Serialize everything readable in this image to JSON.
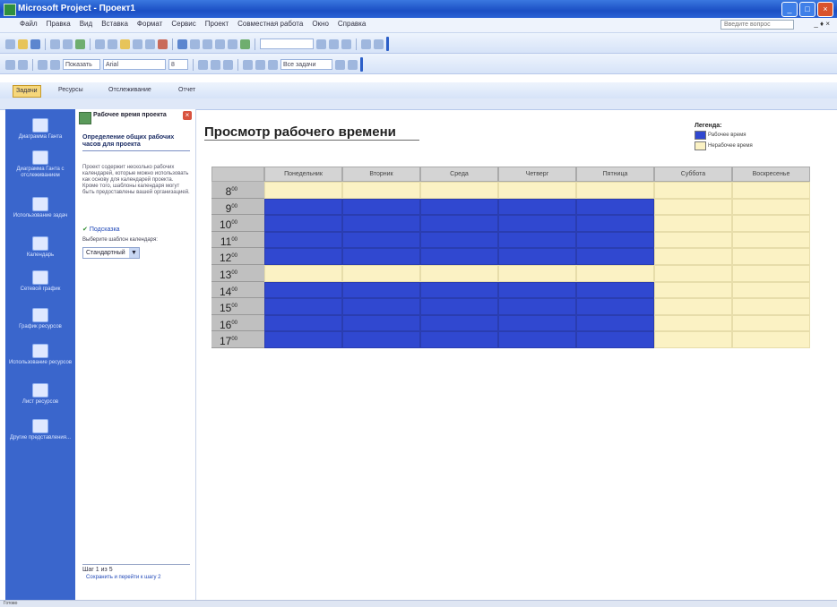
{
  "window": {
    "title": "Microsoft Project - Проект1",
    "buttons": [
      "_",
      "□",
      "×"
    ]
  },
  "menubar": {
    "items": [
      "Файл",
      "Правка",
      "Вид",
      "Вставка",
      "Формат",
      "Сервис",
      "Проект",
      "Совместная работа",
      "Окно",
      "Справка"
    ],
    "help_placeholder": "Введите вопрос",
    "controls": "_ ♦ ×"
  },
  "toolbar": {
    "font_size": "8",
    "font_name": "Arial",
    "filter": "Все задачи",
    "view": "Показать"
  },
  "guide_bar": {
    "tabs": [
      "Задачи",
      "Ресурсы",
      "Отслеживание",
      "Отчет"
    ]
  },
  "left_nav": {
    "items": [
      "Диаграмма Ганта",
      "Диаграмма Ганта с отслеживанием",
      "Использование задач",
      "Календарь",
      "Сетевой график",
      "График ресурсов",
      "Использование ресурсов",
      "Лист ресурсов",
      "Другие представления..."
    ]
  },
  "side_pane": {
    "title": "Рабочее время проекта",
    "subtitle": "Определение общих рабочих часов для проекта",
    "text": "Проект содержит несколько рабочих календарей, которые можно использовать как основу для календарей проекта. Кроме того, шаблоны календаря могут быть предоставлены вашей организацией.",
    "link": "Подсказка",
    "select_label": "Выберите шаблон календаря:",
    "select_value": "Стандартный",
    "step": "Шаг 1 из 5",
    "next": "Сохранить и перейти к шагу 2"
  },
  "view": {
    "title": "Просмотр рабочего времени",
    "legend": {
      "title": "Легенда:",
      "items": [
        {
          "label": "Рабочее время",
          "color": "#3048d0"
        },
        {
          "label": "Нерабочее время",
          "color": "#fbf2c4"
        }
      ]
    },
    "days": [
      "Понедельник",
      "Вторник",
      "Среда",
      "Четверг",
      "Пятница",
      "Суббота",
      "Воскресенье"
    ],
    "hours": [
      "8",
      "9",
      "10",
      "11",
      "12",
      "13",
      "14",
      "15",
      "16",
      "17"
    ],
    "hour_suffix": "00",
    "working_days": [
      "Понедельник",
      "Вторник",
      "Среда",
      "Четверг",
      "Пятница"
    ],
    "working_hours": [
      "9",
      "10",
      "11",
      "12",
      "14",
      "15",
      "16",
      "17"
    ]
  },
  "status": {
    "text": "Готово"
  }
}
